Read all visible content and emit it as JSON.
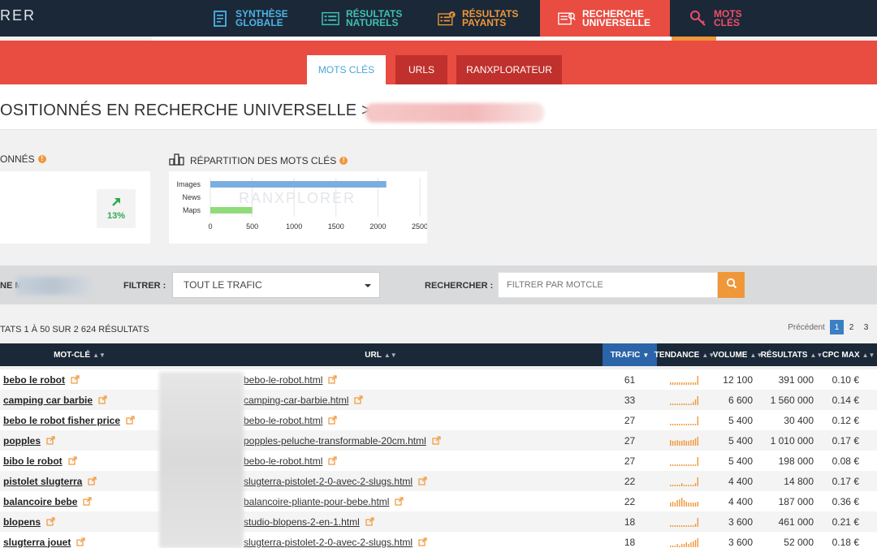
{
  "app": {
    "logo_text": "RER"
  },
  "nav": {
    "items": [
      {
        "line1": "SYNTHÈSE",
        "line2": "GLOBALE",
        "icon": "report-icon"
      },
      {
        "line1": "RÉSULTATS",
        "line2": "NATURELS",
        "icon": "list-icon"
      },
      {
        "line1": "RÉSULTATS",
        "line2": "PAYANTS",
        "icon": "paid-list-icon"
      },
      {
        "line1": "RECHERCHE",
        "line2": "UNIVERSELLE",
        "icon": "universal-search-icon"
      },
      {
        "line1": "MOTS",
        "line2": "CLÉS",
        "icon": "key-icon"
      }
    ],
    "active_index": 3
  },
  "subtabs": {
    "keywords": "MOTS CLÉS",
    "urls": "URLS",
    "ranxplorateur": "RANXPLORATEUR"
  },
  "page": {
    "title": "OSITIONNÉS EN RECHERCHE UNIVERSELLE >"
  },
  "widgets": {
    "positioned_label": "ONNÉS",
    "info_glyph": "!",
    "trend_value": "13%",
    "distribution_label": "RÉPARTITION DES MOTS CLÉS",
    "watermark": "RANXPLORER"
  },
  "chart_data": {
    "type": "bar",
    "orientation": "horizontal",
    "categories": [
      "Images",
      "News",
      "Maps"
    ],
    "values": [
      2100,
      0,
      500
    ],
    "colors": [
      "#7aaee0",
      "#7aaee0",
      "#8fdc7a"
    ],
    "xlim": [
      0,
      2500
    ],
    "xticks": [
      0,
      500,
      1000,
      1500,
      2000,
      2500
    ],
    "grid": true
  },
  "filters": {
    "name_label": "NE M",
    "filter_label": "FILTRER :",
    "filter_value": "TOUT LE TRAFIC",
    "search_label": "RECHERCHER :",
    "search_placeholder": "FILTRER PAR MOTCLE"
  },
  "results": {
    "summary": "TATS 1 À 50 SUR 2 624 RÉSULTATS"
  },
  "pagination": {
    "previous": "Précédent",
    "pages": [
      "1",
      "2",
      "3"
    ],
    "current": "1"
  },
  "table": {
    "columns": {
      "keyword": "MOT-CLÉ",
      "url": "URL",
      "traffic": "TRAFIC",
      "trend": "TENDANCE",
      "volume": "VOLUME",
      "results": "RÉSULTATS",
      "cpc": "CPC MAX"
    },
    "sorted_column": "traffic",
    "rows": [
      {
        "keyword": "bebo le robot",
        "url": "bebo-le-robot.html",
        "traffic": "61",
        "trend": [
          1,
          1,
          1,
          1,
          1,
          1,
          1,
          1,
          1,
          1,
          1,
          1,
          4
        ],
        "volume": "12 100",
        "results": "391 000",
        "cpc": "0.10 €"
      },
      {
        "keyword": "camping car barbie",
        "url": "camping-car-barbie.html",
        "traffic": "33",
        "trend": [
          1,
          1,
          1,
          1,
          1,
          1,
          1,
          1,
          1,
          1,
          2,
          3,
          5
        ],
        "volume": "6 600",
        "results": "1 560 000",
        "cpc": "0.14 €"
      },
      {
        "keyword": "bebo le robot fisher price",
        "url": "bebo-le-robot.html",
        "traffic": "27",
        "trend": [
          1,
          1,
          1,
          1,
          1,
          1,
          1,
          1,
          1,
          1,
          1,
          1,
          5
        ],
        "volume": "5 400",
        "results": "30 400",
        "cpc": "0.12 €"
      },
      {
        "keyword": "popples",
        "url": "popples-peluche-transformable-20cm.html",
        "traffic": "27",
        "trend": [
          4,
          3,
          3,
          4,
          3,
          3,
          4,
          3,
          3,
          4,
          4,
          5,
          6
        ],
        "volume": "5 400",
        "results": "1 010 000",
        "cpc": "0.17 €"
      },
      {
        "keyword": "bibo le robot",
        "url": "bebo-le-robot.html",
        "traffic": "27",
        "trend": [
          1,
          1,
          1,
          1,
          1,
          1,
          1,
          1,
          1,
          1,
          1,
          1,
          5
        ],
        "volume": "5 400",
        "results": "198 000",
        "cpc": "0.08 €"
      },
      {
        "keyword": "pistolet slugterra",
        "url": "slugterra-pistolet-2-0-avec-2-slugs.html",
        "traffic": "22",
        "trend": [
          1,
          1,
          1,
          1,
          1,
          2,
          1,
          1,
          1,
          1,
          1,
          2,
          5
        ],
        "volume": "4 400",
        "results": "14 800",
        "cpc": "0.17 €"
      },
      {
        "keyword": "balancoire bebe",
        "url": "balancoire-pliante-pour-bebe.html",
        "traffic": "22",
        "trend": [
          3,
          4,
          3,
          5,
          6,
          7,
          5,
          4,
          3,
          3,
          3,
          3,
          4
        ],
        "volume": "4 400",
        "results": "187 000",
        "cpc": "0.36 €"
      },
      {
        "keyword": "blopens",
        "url": "studio-blopens-2-en-1.html",
        "traffic": "18",
        "trend": [
          1,
          1,
          1,
          1,
          1,
          1,
          1,
          1,
          1,
          1,
          1,
          2,
          5
        ],
        "volume": "3 600",
        "results": "461 000",
        "cpc": "0.21 €"
      },
      {
        "keyword": "slugterra jouet",
        "url": "slugterra-pistolet-2-0-avec-2-slugs.html",
        "traffic": "18",
        "trend": [
          1,
          1,
          1,
          2,
          1,
          2,
          2,
          3,
          2,
          3,
          4,
          5,
          6
        ],
        "volume": "3 600",
        "results": "52 000",
        "cpc": "0.18 €"
      }
    ]
  },
  "colors": {
    "accent_red": "#e94c40",
    "nav_bg": "#1b2838",
    "orange": "#f0973a",
    "sorted_header": "#2b64a8"
  }
}
